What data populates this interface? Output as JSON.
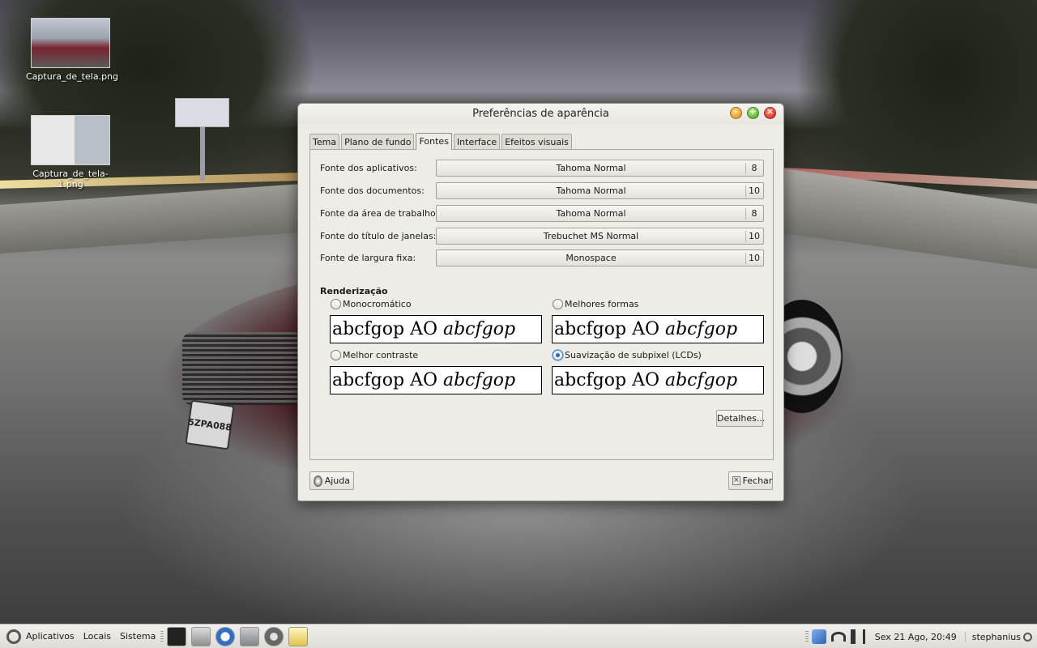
{
  "desktop": {
    "icons": [
      {
        "label": "Captura_de_tela.png"
      },
      {
        "label": "Captura_de_tela-1.png"
      }
    ],
    "car_plate": "5ZPA088"
  },
  "window": {
    "title": "Preferências de aparência",
    "tabs": [
      "Tema",
      "Plano de fundo",
      "Fontes",
      "Interface",
      "Efeitos visuais"
    ],
    "active_tab": "Fontes",
    "fonts": [
      {
        "label": "Fonte dos aplicativos:",
        "font": "Tahoma Normal",
        "size": "8"
      },
      {
        "label": "Fonte dos documentos:",
        "font": "Tahoma Normal",
        "size": "10"
      },
      {
        "label": "Fonte da área de trabalho:",
        "font": "Tahoma Normal",
        "size": "8"
      },
      {
        "label": "Fonte do título de janelas:",
        "font": "Trebuchet MS Normal",
        "size": "10"
      },
      {
        "label": "Fonte de largura fixa:",
        "font": "Monospace",
        "size": "10"
      }
    ],
    "rendering": {
      "title": "Renderização",
      "options": [
        {
          "label": "Monocromático",
          "checked": false
        },
        {
          "label": "Melhores formas",
          "checked": false
        },
        {
          "label": "Melhor contraste",
          "checked": false
        },
        {
          "label": "Suavização de subpixel (LCDs)",
          "checked": true
        }
      ],
      "sample_plain": "abcfgop AO ",
      "sample_italic": "abcfgop"
    },
    "details_button": "Detalhes...",
    "help_button": "Ajuda",
    "close_button": "Fechar"
  },
  "taskbar": {
    "menus": [
      "Aplicativos",
      "Locais",
      "Sistema"
    ],
    "clock": "Sex 21 Ago, 20:49",
    "user": "stephanius"
  }
}
